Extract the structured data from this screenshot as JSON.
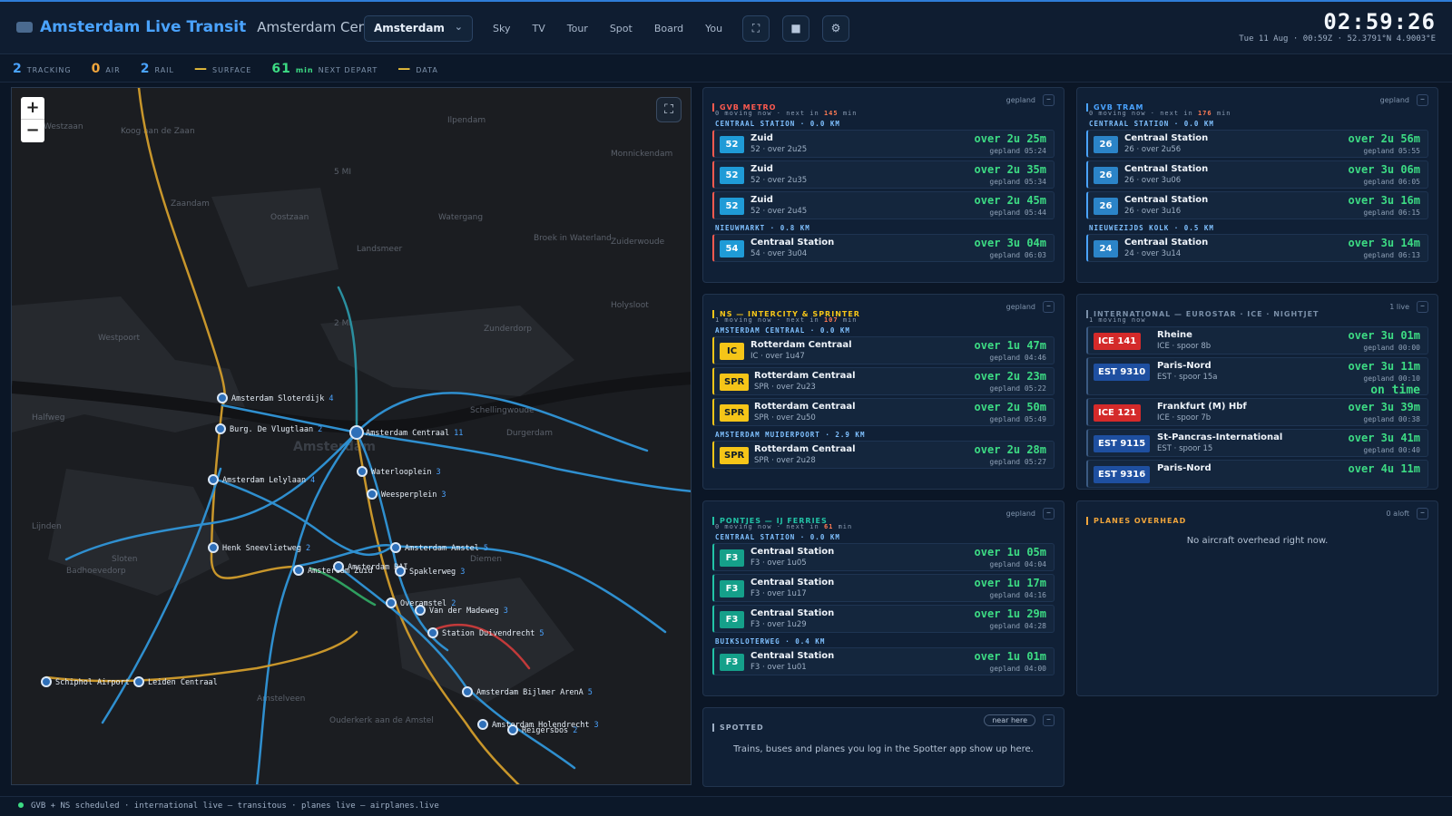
{
  "app": {
    "title": "Amsterdam Live Transit",
    "station": "Amsterdam Centraal",
    "city": "Amsterdam"
  },
  "nav": [
    "Sky",
    "TV",
    "Tour",
    "Spot",
    "Board",
    "You"
  ],
  "clock": {
    "time": "02:59:26",
    "sub": "Tue 11 Aug · 00:59Z · 52.3791°N 4.9003°E"
  },
  "stats": [
    {
      "value": "2",
      "label": "TRACKING",
      "color": "#4aa3ff"
    },
    {
      "value": "0",
      "label": "AIR",
      "color": "#f0a53c"
    },
    {
      "value": "2",
      "label": "RAIL",
      "color": "#4aa3ff"
    },
    {
      "value": "—",
      "label": "SURFACE",
      "color": "#f0c53c"
    },
    {
      "value": "61",
      "unit": "min",
      "label": "NEXT DEPART",
      "color": "#3ddc84"
    },
    {
      "value": "—",
      "label": "DATA",
      "color": "#f0c53c"
    }
  ],
  "map": {
    "areas": [
      "Westzaan",
      "Koog aan de Zaan",
      "Zaandam",
      "Oostzaan",
      "Ilpendam",
      "Monnickendam",
      "Watergang",
      "Landsmeer",
      "Broek in Waterland",
      "Zuiderwoude",
      "Holysloot",
      "Westpoort",
      "Zunderdorp",
      "Schellingwoude",
      "Durgerdam",
      "Halfweg",
      "Lijnden",
      "Sloten",
      "Badhoevedorp",
      "Diemen",
      "Amstelveen",
      "Ouderkerk aan de Amstel",
      "Amsterdam",
      "5 MI",
      "2 MI"
    ],
    "stations": [
      {
        "name": "Amsterdam Sloterdijk",
        "count": "4"
      },
      {
        "name": "Burg. De Vlugtlaan",
        "count": "2"
      },
      {
        "name": "Amsterdam Centraal",
        "count": "11"
      },
      {
        "name": "Amsterdam Lelylaan",
        "count": "4"
      },
      {
        "name": "Waterlooplein",
        "count": "3"
      },
      {
        "name": "Weesperplein",
        "count": "3"
      },
      {
        "name": "Henk Sneevlietweg",
        "count": "2"
      },
      {
        "name": "Amsterdam Amstel",
        "count": "5"
      },
      {
        "name": "Amsterdam Zuid",
        "count": ""
      },
      {
        "name": "Amsterdam RAI",
        "count": ""
      },
      {
        "name": "Spaklerweg",
        "count": "3"
      },
      {
        "name": "Overamstel",
        "count": "2"
      },
      {
        "name": "Van der Madeweg",
        "count": "3"
      },
      {
        "name": "Station Duivendrecht",
        "count": "5"
      },
      {
        "name": "Schiphol Airport",
        "count": "4"
      },
      {
        "name": "Leiden Centraal",
        "count": ""
      },
      {
        "name": "Amsterdam Bijlmer ArenA",
        "count": "5"
      },
      {
        "name": "Amsterdam Holendrecht",
        "count": "3"
      },
      {
        "name": "Reigersbos",
        "count": "2"
      }
    ]
  },
  "panels": {
    "metro": {
      "title": "GVB METRO",
      "right": "gepland",
      "moving": "0 moving now · next in",
      "next": "145",
      "next_unit": "min",
      "sections": [
        {
          "name": "CENTRAAL STATION · 0.0 KM",
          "rows": [
            {
              "badge": "52",
              "dest": "Zuid",
              "info": "52 · over 2u25",
              "due": "over 2u 25m",
              "sched": "gepland 05:24"
            },
            {
              "badge": "52",
              "dest": "Zuid",
              "info": "52 · over 2u35",
              "due": "over 2u 35m",
              "sched": "gepland 05:34"
            },
            {
              "badge": "52",
              "dest": "Zuid",
              "info": "52 · over 2u45",
              "due": "over 2u 45m",
              "sched": "gepland 05:44"
            }
          ]
        },
        {
          "name": "NIEUWMARKT · 0.8 KM",
          "rows": [
            {
              "badge": "54",
              "dest": "Centraal Station",
              "info": "54 · over 3u04",
              "due": "over 3u 04m",
              "sched": "gepland 06:03"
            }
          ]
        }
      ]
    },
    "tram": {
      "title": "GVB TRAM",
      "right": "gepland",
      "moving": "0 moving now · next in",
      "next": "176",
      "next_unit": "min",
      "sections": [
        {
          "name": "CENTRAAL STATION · 0.0 KM",
          "rows": [
            {
              "badge": "26",
              "dest": "Centraal Station",
              "info": "26 · over 2u56",
              "due": "over 2u 56m",
              "sched": "gepland 05:55"
            },
            {
              "badge": "26",
              "dest": "Centraal Station",
              "info": "26 · over 3u06",
              "due": "over 3u 06m",
              "sched": "gepland 06:05"
            },
            {
              "badge": "26",
              "dest": "Centraal Station",
              "info": "26 · over 3u16",
              "due": "over 3u 16m",
              "sched": "gepland 06:15"
            }
          ]
        },
        {
          "name": "NIEUWEZIJDS KOLK · 0.5 KM",
          "rows": [
            {
              "badge": "24",
              "dest": "Centraal Station",
              "info": "24 · over 3u14",
              "due": "over 3u 14m",
              "sched": "gepland 06:13"
            }
          ]
        }
      ]
    },
    "ns": {
      "title": "NS — INTERCITY & SPRINTER",
      "right": "gepland",
      "moving": "1 moving now · next in",
      "next": "107",
      "next_unit": "min",
      "sections": [
        {
          "name": "AMSTERDAM CENTRAAL · 0.0 KM",
          "rows": [
            {
              "badge": "IC",
              "dest": "Rotterdam Centraal",
              "info": "IC · over 1u47",
              "due": "over 1u 47m",
              "sched": "gepland 04:46"
            },
            {
              "badge": "SPR",
              "dest": "Rotterdam Centraal",
              "info": "SPR · over 2u23",
              "due": "over 2u 23m",
              "sched": "gepland 05:22"
            },
            {
              "badge": "SPR",
              "dest": "Rotterdam Centraal",
              "info": "SPR · over 2u50",
              "due": "over 2u 50m",
              "sched": "gepland 05:49"
            }
          ]
        },
        {
          "name": "AMSTERDAM MUIDERPOORT · 2.9 KM",
          "rows": [
            {
              "badge": "SPR",
              "dest": "Rotterdam Centraal",
              "info": "SPR · over 2u28",
              "due": "over 2u 28m",
              "sched": "gepland 05:27"
            }
          ]
        }
      ]
    },
    "intl": {
      "title": "INTERNATIONAL — EUROSTAR · ICE · NIGHTJET",
      "right": "1 live",
      "moving": "1 moving now",
      "rows": [
        {
          "badge": "ICE 141",
          "dest": "Rheine",
          "info": "ICE · spoor 8b",
          "due": "over 3u 01m",
          "sched": "gepland 00:00",
          "kind": "ice"
        },
        {
          "badge": "EST 9310",
          "dest": "Paris-Nord",
          "info": "EST · spoor 15a",
          "due": "over 3u 11m",
          "sched": "gepland 00:10",
          "status": "on time",
          "kind": "est"
        },
        {
          "badge": "ICE 121",
          "dest": "Frankfurt (M) Hbf",
          "info": "ICE · spoor 7b",
          "due": "over 3u 39m",
          "sched": "gepland 00:38",
          "kind": "ice"
        },
        {
          "badge": "EST 9115",
          "dest": "St-Pancras-International",
          "info": "EST · spoor 15",
          "due": "over 3u 41m",
          "sched": "gepland 00:40",
          "kind": "est"
        },
        {
          "badge": "EST 9316",
          "dest": "Paris-Nord",
          "info": "",
          "due": "over 4u 11m",
          "sched": "",
          "kind": "est"
        }
      ]
    },
    "ferries": {
      "title": "PONTJES — IJ FERRIES",
      "right": "gepland",
      "moving": "0 moving now · next in",
      "next": "61",
      "next_unit": "min",
      "sections": [
        {
          "name": "CENTRAAL STATION · 0.0 KM",
          "rows": [
            {
              "badge": "F3",
              "dest": "Centraal Station",
              "info": "F3 · over 1u05",
              "due": "over 1u 05m",
              "sched": "gepland 04:04"
            },
            {
              "badge": "F3",
              "dest": "Centraal Station",
              "info": "F3 · over 1u17",
              "due": "over 1u 17m",
              "sched": "gepland 04:16"
            },
            {
              "badge": "F3",
              "dest": "Centraal Station",
              "info": "F3 · over 1u29",
              "due": "over 1u 29m",
              "sched": "gepland 04:28"
            }
          ]
        },
        {
          "name": "BUIKSLOTERWEG · 0.4 KM",
          "rows": [
            {
              "badge": "F3",
              "dest": "Centraal Station",
              "info": "F3 · over 1u01",
              "due": "over 1u 01m",
              "sched": "gepland 04:00"
            }
          ]
        }
      ]
    },
    "planes": {
      "title": "PLANES OVERHEAD",
      "right": "0 aloft",
      "empty": "No aircraft overhead right now."
    },
    "spotted": {
      "title": "SPOTTED",
      "pill": "near here",
      "empty": "Trains, buses and planes you log in the Spotter app show up here."
    }
  },
  "footer": "GVB + NS scheduled · international live — transitous · planes live — airplanes.live"
}
